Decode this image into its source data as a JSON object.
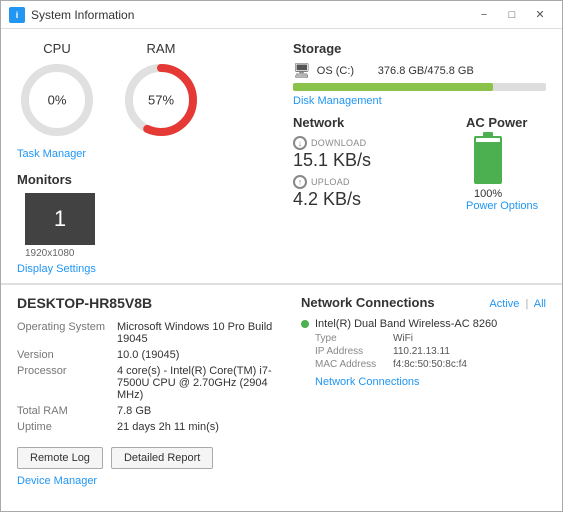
{
  "window": {
    "title": "System Information",
    "icon_char": "i"
  },
  "titlebar": {
    "minimize": "−",
    "maximize": "□",
    "close": "✕"
  },
  "cpu": {
    "label": "CPU",
    "percent": "0%",
    "used_deg": 0,
    "track_color": "#e0e0e0",
    "fill_color": "#e0e0e0"
  },
  "ram": {
    "label": "RAM",
    "percent": "57%",
    "used_deg": 205,
    "track_color": "#e0e0e0",
    "fill_color": "#e53935"
  },
  "task_manager_link": "Task Manager",
  "monitors": {
    "title": "Monitors",
    "count": "1",
    "resolution": "1920x1080",
    "settings_link": "Display Settings"
  },
  "storage": {
    "title": "Storage",
    "drive_name": "OS (C:)",
    "used_gb": "376.8 GB",
    "total_gb": "475.8 GB",
    "fill_percent": 79,
    "disk_mgmt_link": "Disk Management"
  },
  "network": {
    "title": "Network",
    "download_label": "DOWNLOAD",
    "download_value": "15.1 KB/s",
    "upload_label": "UPLOAD",
    "upload_value": "4.2 KB/s"
  },
  "ac_power": {
    "title": "AC Power",
    "percent": "100%",
    "fill_height": 90,
    "options_link": "Power Options"
  },
  "system": {
    "computer_name": "DESKTOP-HR85V8B",
    "rows": [
      {
        "label": "Operating System",
        "value": "Microsoft Windows 10 Pro Build 19045"
      },
      {
        "label": "Version",
        "value": "10.0 (19045)"
      },
      {
        "label": "Processor",
        "value": "4 core(s) - Intel(R) Core(TM) i7-7500U CPU @ 2.70GHz (2904 MHz)"
      },
      {
        "label": "Total RAM",
        "value": "7.8 GB"
      },
      {
        "label": "Uptime",
        "value": "21 days 2h 11 min(s)"
      }
    ]
  },
  "buttons": {
    "remote_log": "Remote Log",
    "detailed_report": "Detailed Report"
  },
  "device_manager_link": "Device Manager",
  "network_connections": {
    "title": "Network Connections",
    "active_link": "Active",
    "all_link": "All",
    "connection": {
      "name": "Intel(R) Dual Band Wireless-AC 8260",
      "dot_color": "#4CAF50",
      "details": [
        {
          "label": "Type",
          "value": "WiFi"
        },
        {
          "label": "IP Address",
          "value": "110.21.13.11"
        },
        {
          "label": "MAC Address",
          "value": "f4:8c:50:50:8c:f4"
        }
      ]
    },
    "footer_link": "Network Connections"
  }
}
